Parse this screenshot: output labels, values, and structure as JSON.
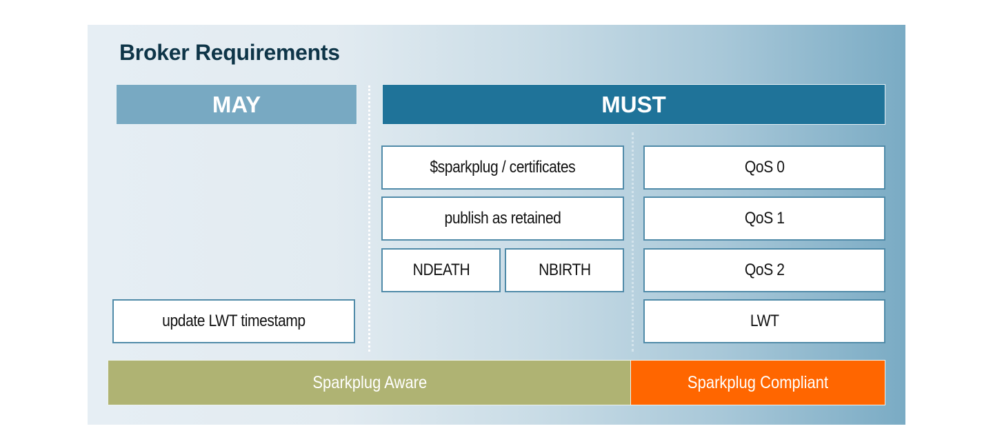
{
  "title": "Broker Requirements",
  "columns": {
    "may": {
      "label": "MAY",
      "color": "#78a9c2"
    },
    "must": {
      "label": "MUST",
      "color": "#1f7399"
    }
  },
  "may_items": [
    "update LWT timestamp"
  ],
  "must_aware_items": {
    "sparkplug_certificates": "$sparkplug / certificates",
    "publish_retained": "publish as retained",
    "ndeath": "NDEATH",
    "nbirth": "NBIRTH"
  },
  "must_compliant_items": [
    "QoS 0",
    "QoS 1",
    "QoS 2",
    "LWT"
  ],
  "levels": {
    "aware": {
      "label": "Sparkplug Aware",
      "color": "#afb373"
    },
    "compliant": {
      "label": "Sparkplug Compliant",
      "color": "#ff6600"
    }
  }
}
